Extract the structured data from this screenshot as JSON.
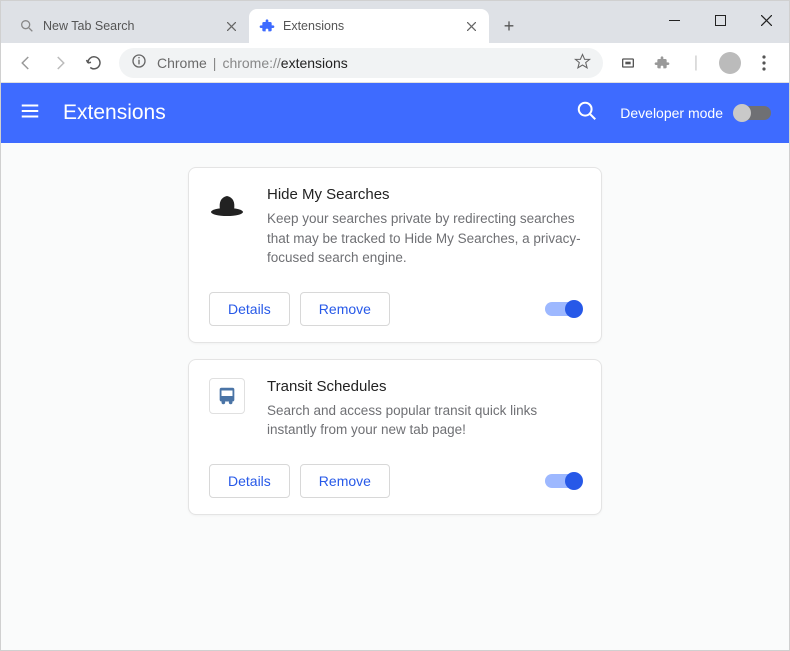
{
  "window": {
    "tabs": [
      {
        "title": "New Tab Search",
        "active": false,
        "icon": "search"
      },
      {
        "title": "Extensions",
        "active": true,
        "icon": "puzzle"
      }
    ]
  },
  "omnibox": {
    "scheme_label": "Chrome",
    "url_prefix": "chrome://",
    "url_suffix": "extensions"
  },
  "header": {
    "title": "Extensions",
    "dev_mode_label": "Developer mode",
    "dev_mode_on": false
  },
  "extensions": [
    {
      "icon": "hat",
      "name": "Hide My Searches",
      "description": "Keep your searches private by redirecting searches that may be tracked to Hide My Searches, a privacy-focused search engine.",
      "details_label": "Details",
      "remove_label": "Remove",
      "enabled": true
    },
    {
      "icon": "bus",
      "name": "Transit Schedules",
      "description": "Search and access popular transit quick links instantly from your new tab page!",
      "details_label": "Details",
      "remove_label": "Remove",
      "enabled": true
    }
  ]
}
